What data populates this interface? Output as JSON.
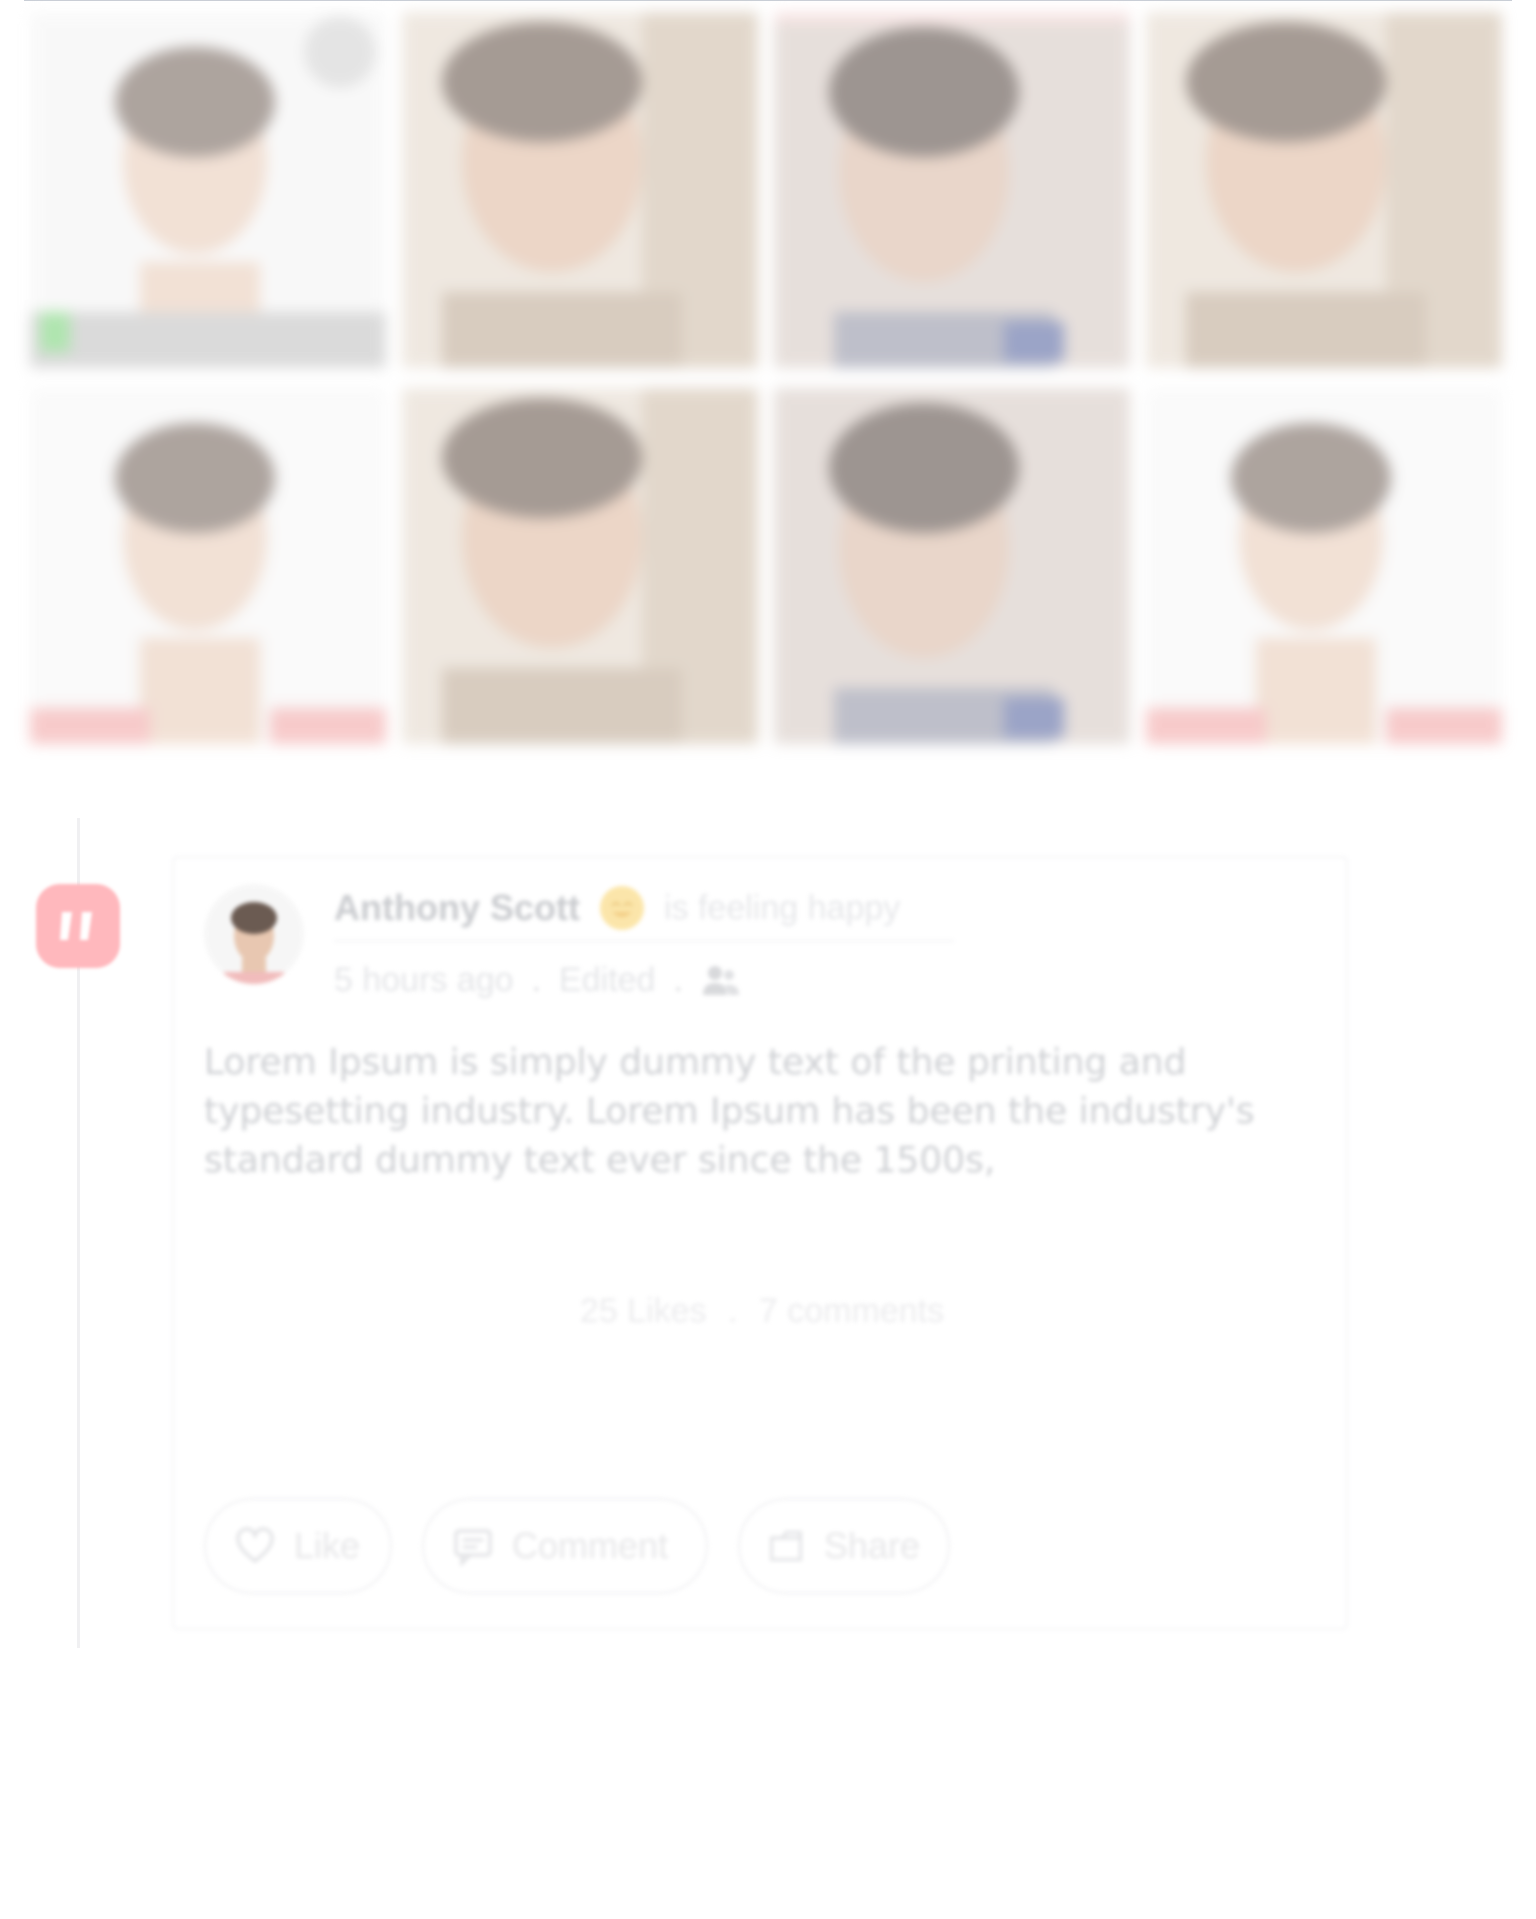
{
  "gallery": {
    "photos": [
      {
        "icon": "portrait-photo",
        "bg": "#f2f2f2"
      },
      {
        "icon": "portrait-photo",
        "bg": "#d9c9b8"
      },
      {
        "icon": "portrait-photo",
        "bg": "#cfc4bd"
      },
      {
        "icon": "portrait-photo",
        "bg": "#d9c9b8"
      },
      {
        "icon": "portrait-photo",
        "bg": "#f2f2f2"
      },
      {
        "icon": "portrait-photo",
        "bg": "#d9c9b8"
      },
      {
        "icon": "portrait-photo",
        "bg": "#cfc4bd"
      },
      {
        "icon": "portrait-photo",
        "bg": "#f2f2f2"
      }
    ]
  },
  "timeline": {
    "badge_icon": "quote-icon",
    "badge_color": "#ffb8bd"
  },
  "post": {
    "author_name": "Anthony Scott",
    "feeling_emoji": "smiling-face-icon",
    "feeling_text": "is feeling happy",
    "timestamp": "5 hours ago",
    "edited_label": "Edited",
    "meta_separator": ".",
    "audience_icon": "friends-icon",
    "body_text": "Lorem Ipsum is simply dummy text of the printing and typesetting industry. Lorem Ipsum has been the industry's standard dummy text ever since the 1500s,",
    "likes_count": "25 Likes",
    "stats_separator": ".",
    "comments_count": "7 comments",
    "actions": {
      "like_label": "Like",
      "comment_label": "Comment",
      "share_label": "Share"
    }
  }
}
